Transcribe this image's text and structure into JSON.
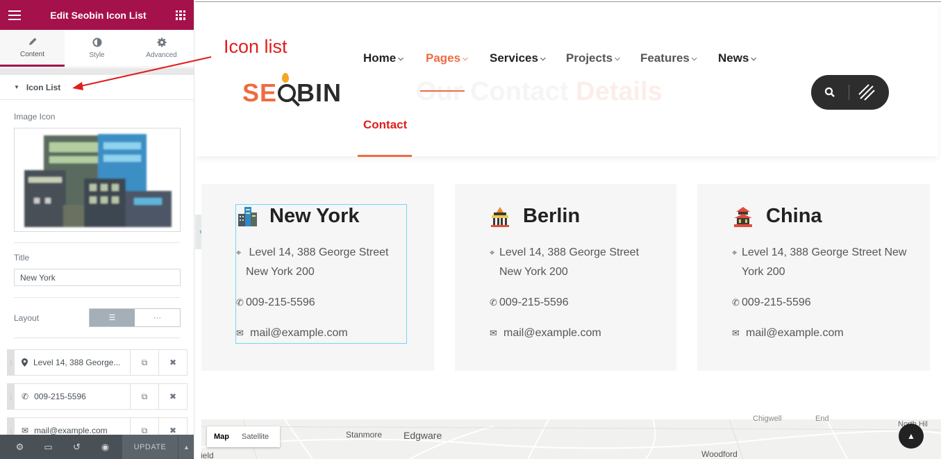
{
  "panel": {
    "title": "Edit Seobin Icon List",
    "tabs": [
      {
        "label": "Content",
        "icon": "pencil-icon",
        "active": true
      },
      {
        "label": "Style",
        "icon": "contrast-icon",
        "active": false
      },
      {
        "label": "Advanced",
        "icon": "gear-icon",
        "active": false
      }
    ],
    "section": "Icon List",
    "image_label": "Image Icon",
    "title_label": "Title",
    "title_value": "New York",
    "layout_label": "Layout",
    "layout_options": [
      "☰",
      "···"
    ],
    "items": [
      {
        "icon": "map-marker-icon",
        "text": "Level 14, 388 George..."
      },
      {
        "icon": "phone-icon",
        "text": "009-215-5596"
      },
      {
        "icon": "envelope-icon",
        "text": "mail@example.com"
      }
    ],
    "footer": {
      "update": "UPDATE"
    }
  },
  "site": {
    "logo_left": "SE",
    "logo_right": "BIN",
    "nav": [
      {
        "label": "Home",
        "color": "#222222"
      },
      {
        "label": "Pages",
        "color": "#ef6b42"
      },
      {
        "label": "Services",
        "color": "#222222"
      },
      {
        "label": "Projects",
        "color": "#555555"
      },
      {
        "label": "Features",
        "color": "#555555"
      },
      {
        "label": "News",
        "color": "#222222"
      }
    ],
    "nav_contact": "Contact",
    "ghost_title": "Our Contact ",
    "ghost_title_accent": "Details",
    "locations": [
      {
        "title": "New York",
        "address": [
          "Level 14, 388 George Street",
          "New York 200"
        ],
        "phone": "009-215-5596",
        "email": "mail@example.com"
      },
      {
        "title": "Berlin",
        "address": [
          "Level 14, 388 George Street",
          "New York 200"
        ],
        "phone": "009-215-5596",
        "email": "mail@example.com"
      },
      {
        "title": "China",
        "address": [
          "Level 14, 388 George Street New",
          "York 200"
        ],
        "phone": "009-215-5596",
        "email": "mail@example.com"
      }
    ],
    "map": {
      "buttons": [
        "Map",
        "Satellite"
      ],
      "labels": [
        "Stanmore",
        "Edgware",
        "Woodford",
        "ield",
        "Chigwell",
        "End",
        "North Hil"
      ]
    }
  },
  "annotation": "Icon list",
  "colors": {
    "brand": "#a5114b",
    "accent": "#ef6b42",
    "annotation": "#e11d1d"
  }
}
